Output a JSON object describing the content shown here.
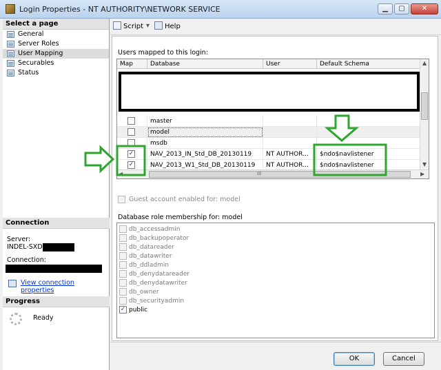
{
  "window": {
    "title": "Login Properties - NT AUTHORITY\\NETWORK SERVICE",
    "minimize": "▁",
    "maximize": "▢",
    "close": "✕"
  },
  "left": {
    "select_page_header": "Select a page",
    "pages": [
      "General",
      "Server Roles",
      "User Mapping",
      "Securables",
      "Status"
    ],
    "selected_page": "User Mapping",
    "connection_header": "Connection",
    "server_label": "Server:",
    "server_value": "INDEL-SXD",
    "connection_label": "Connection:",
    "view_connection_link": "View connection properties",
    "progress_header": "Progress",
    "progress_status": "Ready"
  },
  "toolbar": {
    "script_label": "Script",
    "dropdown_glyph": "▾",
    "help_label": "Help"
  },
  "mapping": {
    "users_mapped_label": "Users mapped to this login:",
    "columns": [
      "Map",
      "Database",
      "User",
      "Default Schema"
    ],
    "rows": [
      {
        "checked": false,
        "database": "master",
        "user": "",
        "schema": ""
      },
      {
        "checked": false,
        "database": "model",
        "user": "",
        "schema": ""
      },
      {
        "checked": false,
        "database": "msdb",
        "user": "",
        "schema": ""
      },
      {
        "checked": true,
        "database": "NAV_2013_IN_Std_DB_20130119",
        "user": "NT AUTHOR...",
        "schema": "$ndo$navlistener"
      },
      {
        "checked": true,
        "database": "NAV_2013_W1_Std_DB_20130119",
        "user": "NT AUTHOR...",
        "schema": "$ndo$navlistener"
      }
    ],
    "check_glyph": "✓",
    "hscroll_glyph": "III",
    "up_arrow": "▲",
    "down_arrow": "▼",
    "left_arrow": "◀",
    "right_arrow": "▶",
    "guest_label": "Guest account enabled for: model",
    "role_membership_label": "Database role membership for: model"
  },
  "roles": [
    {
      "name": "db_accessadmin",
      "checked": false
    },
    {
      "name": "db_backupoperator",
      "checked": false
    },
    {
      "name": "db_datareader",
      "checked": false
    },
    {
      "name": "db_datawriter",
      "checked": false
    },
    {
      "name": "db_ddladmin",
      "checked": false
    },
    {
      "name": "db_denydatareader",
      "checked": false
    },
    {
      "name": "db_denydatawriter",
      "checked": false
    },
    {
      "name": "db_owner",
      "checked": false
    },
    {
      "name": "db_securityadmin",
      "checked": false
    },
    {
      "name": "public",
      "checked": true
    }
  ],
  "footer": {
    "ok_label": "OK",
    "cancel_label": "Cancel"
  },
  "colors": {
    "annotation_green": "#2ea52e",
    "link_blue": "#0033cc"
  }
}
